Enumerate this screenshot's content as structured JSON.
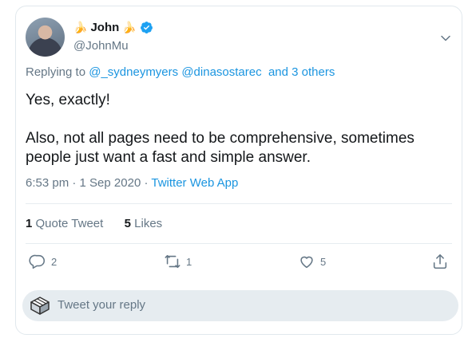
{
  "author": {
    "name": "John",
    "handle": "@JohnMu",
    "name_decoration": "🍌"
  },
  "replying": {
    "prefix": "Replying to",
    "users": [
      "@_sydneymyers",
      "@dinasostarec"
    ],
    "others": "and 3 others"
  },
  "tweet": {
    "line1": "Yes, exactly!",
    "line2": "Also, not all pages need to be comprehensive, sometimes people just want a fast and simple answer."
  },
  "meta": {
    "time": "6:53 pm",
    "sep": "·",
    "date": "1 Sep 2020",
    "app": "Twitter Web App"
  },
  "stats": {
    "quote_count": "1",
    "quote_label": "Quote Tweet",
    "like_count": "5",
    "like_label": "Likes"
  },
  "actions": {
    "reply_count": "2",
    "retweet_count": "1",
    "like_count": "5"
  },
  "reply_box": {
    "placeholder": "Tweet your reply"
  },
  "icons": {
    "verified": "verified-badge-icon",
    "more": "chevron-down-icon",
    "reply": "reply-bubble-icon",
    "retweet": "retweet-icon",
    "like": "heart-icon",
    "share": "share-icon"
  },
  "colors": {
    "link": "#1b95e0",
    "muted": "#657786",
    "text": "#14171a",
    "verified": "#1da1f2"
  }
}
